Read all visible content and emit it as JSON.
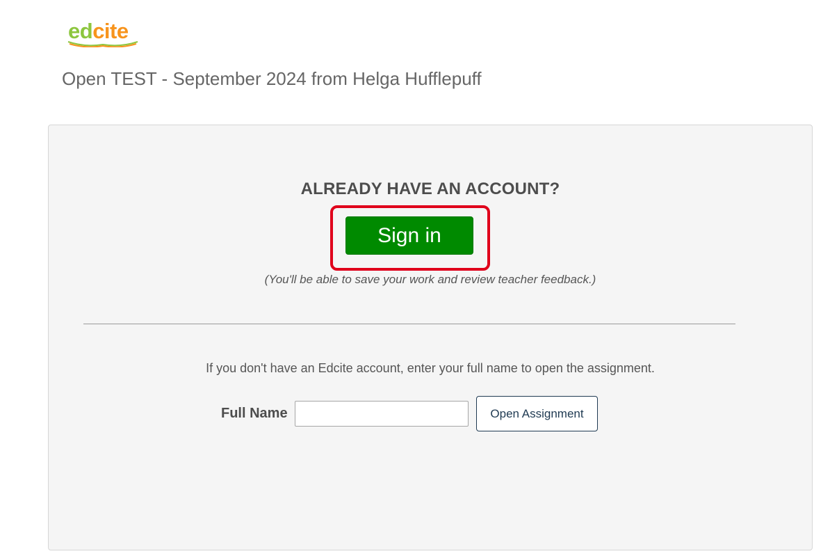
{
  "logo": {
    "text_ed": "ed",
    "text_cite": "cite",
    "colors": {
      "ed": "#8dc63f",
      "cite": "#f7941d"
    }
  },
  "header": {
    "title": "Open TEST - September 2024 from Helga Hufflepuff"
  },
  "signin_section": {
    "heading": "ALREADY HAVE AN ACCOUNT?",
    "button_label": "Sign in",
    "note": "(You'll be able to save your work and review teacher feedback.)",
    "button_color": "#008a00",
    "highlight_color": "#e0001b"
  },
  "guest_section": {
    "instructions": "If you don't have an Edcite account, enter your full name to open the assignment.",
    "fullname_label": "Full Name",
    "fullname_value": "",
    "fullname_placeholder": "",
    "open_button_label": "Open Assignment"
  }
}
